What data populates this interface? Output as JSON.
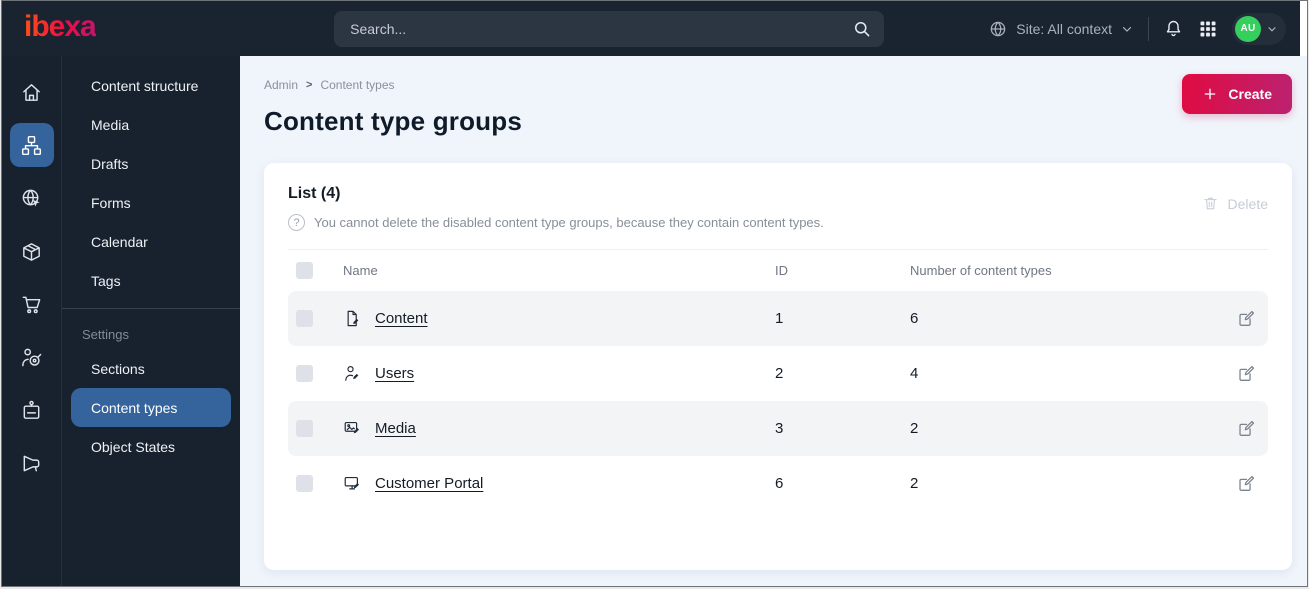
{
  "topbar": {
    "logo_text": "ibexa",
    "search": {
      "placeholder": "Search...",
      "icon": "search-icon"
    },
    "site_context": {
      "label": "Site: All context",
      "icon": "globe-icon",
      "chevron": "chevron-down-icon"
    },
    "icons": {
      "notifications": "bell-icon",
      "apps": "grid-icon"
    },
    "user": {
      "initials": "AU",
      "chevron": "chevron-down-icon"
    }
  },
  "sidebar": {
    "rail_icons": [
      "home-icon",
      "content-tree-icon",
      "site-globe-icon",
      "product-box-icon",
      "cart-icon",
      "personalization-target-icon",
      "corporate-badge-icon",
      "megaphone-icon"
    ],
    "active_rail_icon": "content-tree-icon",
    "items": [
      "Content structure",
      "Media",
      "Drafts",
      "Forms",
      "Calendar",
      "Tags"
    ],
    "settings_label": "Settings",
    "settings_items": [
      "Sections",
      "Content types",
      "Object States"
    ],
    "active_item": "Content types"
  },
  "main": {
    "breadcrumb": {
      "items": [
        "Admin",
        "Content types"
      ],
      "separator": ">"
    },
    "create_button": "Create",
    "page_title": "Content type groups",
    "card": {
      "list_title": "List (4)",
      "note": "You cannot delete the disabled content type groups, because they contain content types.",
      "delete_button": "Delete",
      "table": {
        "columns": {
          "name": "Name",
          "id": "ID",
          "count": "Number of content types"
        },
        "rows": [
          {
            "icon": "file-edit-icon",
            "name": "Content",
            "id": "1",
            "count": "6"
          },
          {
            "icon": "user-edit-icon",
            "name": "Users",
            "id": "2",
            "count": "4"
          },
          {
            "icon": "image-edit-icon",
            "name": "Media",
            "id": "3",
            "count": "2"
          },
          {
            "icon": "monitor-edit-icon",
            "name": "Customer Portal",
            "id": "6",
            "count": "2"
          }
        ]
      }
    }
  },
  "colors": {
    "topbar_bg": "#1a2330",
    "active_blue": "#35639c",
    "brand_gradient_start": "#e00b41",
    "brand_gradient_end": "#bb2271",
    "avatar_green": "#35cf5e",
    "main_bg": "#f0f4fb",
    "row_stripe": "#f3f4f6"
  }
}
